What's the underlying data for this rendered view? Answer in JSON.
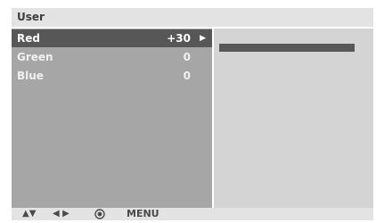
{
  "header": {
    "title": "User"
  },
  "menu": {
    "items": [
      {
        "label": "Red",
        "value": "+30",
        "selected": true,
        "arrow": "▶"
      },
      {
        "label": "Green",
        "value": "0",
        "selected": false
      },
      {
        "label": "Blue",
        "value": "0",
        "selected": false
      }
    ]
  },
  "adjustment": {
    "level_fraction": 1.0
  },
  "footer": {
    "updown": "▲▼",
    "leftright": "◀ ▶",
    "ok_icon": "ok-circle-icon",
    "menu": "MENU"
  },
  "colors": {
    "selected_bg": "#575757",
    "left_panel_bg": "#a6a6a6",
    "right_panel_bg": "#d4d4d4",
    "bar_bg": "#e3e3e3"
  }
}
